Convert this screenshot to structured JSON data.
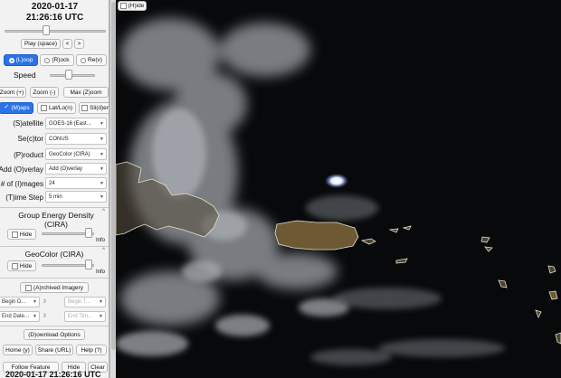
{
  "header": {
    "date": "2020-01-17",
    "time": "21:26:16 UTC"
  },
  "playback": {
    "play": "Play (space)",
    "prev": "<",
    "next": ">",
    "loop": "(L)oop",
    "rock": "(R)ock",
    "rev": "Re(v)",
    "speed_label": "Speed"
  },
  "zoom": {
    "in": "Zoom (+)",
    "out": "Zoom (-)",
    "max": "Max (Z)oom"
  },
  "toggles": {
    "maps": "(M)aps",
    "latlon": "Lat/Lo(n)",
    "slider": "Sli(d)er"
  },
  "fields": [
    {
      "label": "(S)atellite",
      "value": "GOES-16 (East..."
    },
    {
      "label": "Se(c)tor",
      "value": "CONUS"
    },
    {
      "label": "(P)roduct",
      "value": "GeoColor (CIRA)"
    },
    {
      "label": "Add (O)verlay",
      "value": "Add (O)verlay"
    },
    {
      "label": "# of (I)mages",
      "value": "24"
    },
    {
      "label": "(T)ime Step",
      "value": "5 min"
    }
  ],
  "layers": [
    {
      "title": "Group Energy Density (CIRA)",
      "hide": "Hide",
      "info": "Info",
      "corner": "^"
    },
    {
      "title": "GeoColor (CIRA)",
      "hide": "Hide",
      "info": "Info",
      "corner": "^"
    }
  ],
  "archive": {
    "title": "(A)rchived Imagery",
    "begin_date": "Begin D...",
    "begin_time": "Begin T...",
    "end_date": "End Date...",
    "end_time": "End Tim..."
  },
  "bottom": {
    "download": "(D)ownload Options",
    "home": "Home (y)",
    "share": "Share (URL)",
    "help": "Help (?)",
    "follow": "Follow Feature",
    "hide": "Hide",
    "clear": "Clear"
  },
  "footer_time": "2020-01-17 21:26:16 UTC",
  "map": {
    "hide_button": "(H)ide"
  }
}
